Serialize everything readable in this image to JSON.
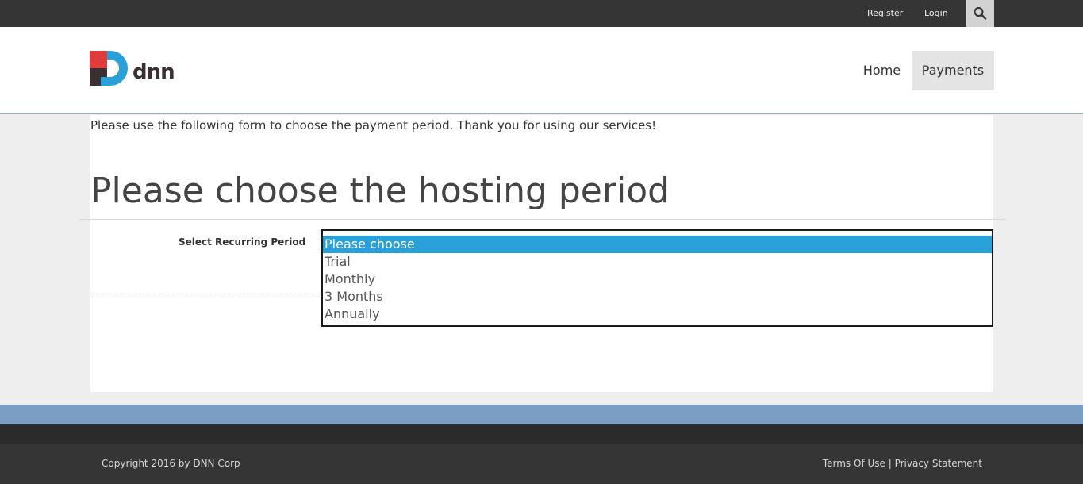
{
  "topbar": {
    "register": "Register",
    "login": "Login",
    "search_icon": "search-icon"
  },
  "header": {
    "logo_text": "dnn",
    "nav": {
      "home": "Home",
      "payments": "Payments"
    }
  },
  "content": {
    "intro": "Please use the following form to choose the payment period. Thank you for using our services!",
    "heading": "Please choose the hosting period",
    "field_label": "Select Recurring Period",
    "options": [
      "Please choose",
      "Trial",
      "Monthly",
      "3 Months",
      "Annually"
    ],
    "selected": "Please choose"
  },
  "footer": {
    "copyright": "Copyright 2016 by DNN Corp",
    "terms": "Terms Of Use",
    "separator": "|",
    "privacy": "Privacy Statement"
  },
  "colors": {
    "accent": "#2aa0d8",
    "topbar": "#353535",
    "band": "#7b9ec4"
  }
}
